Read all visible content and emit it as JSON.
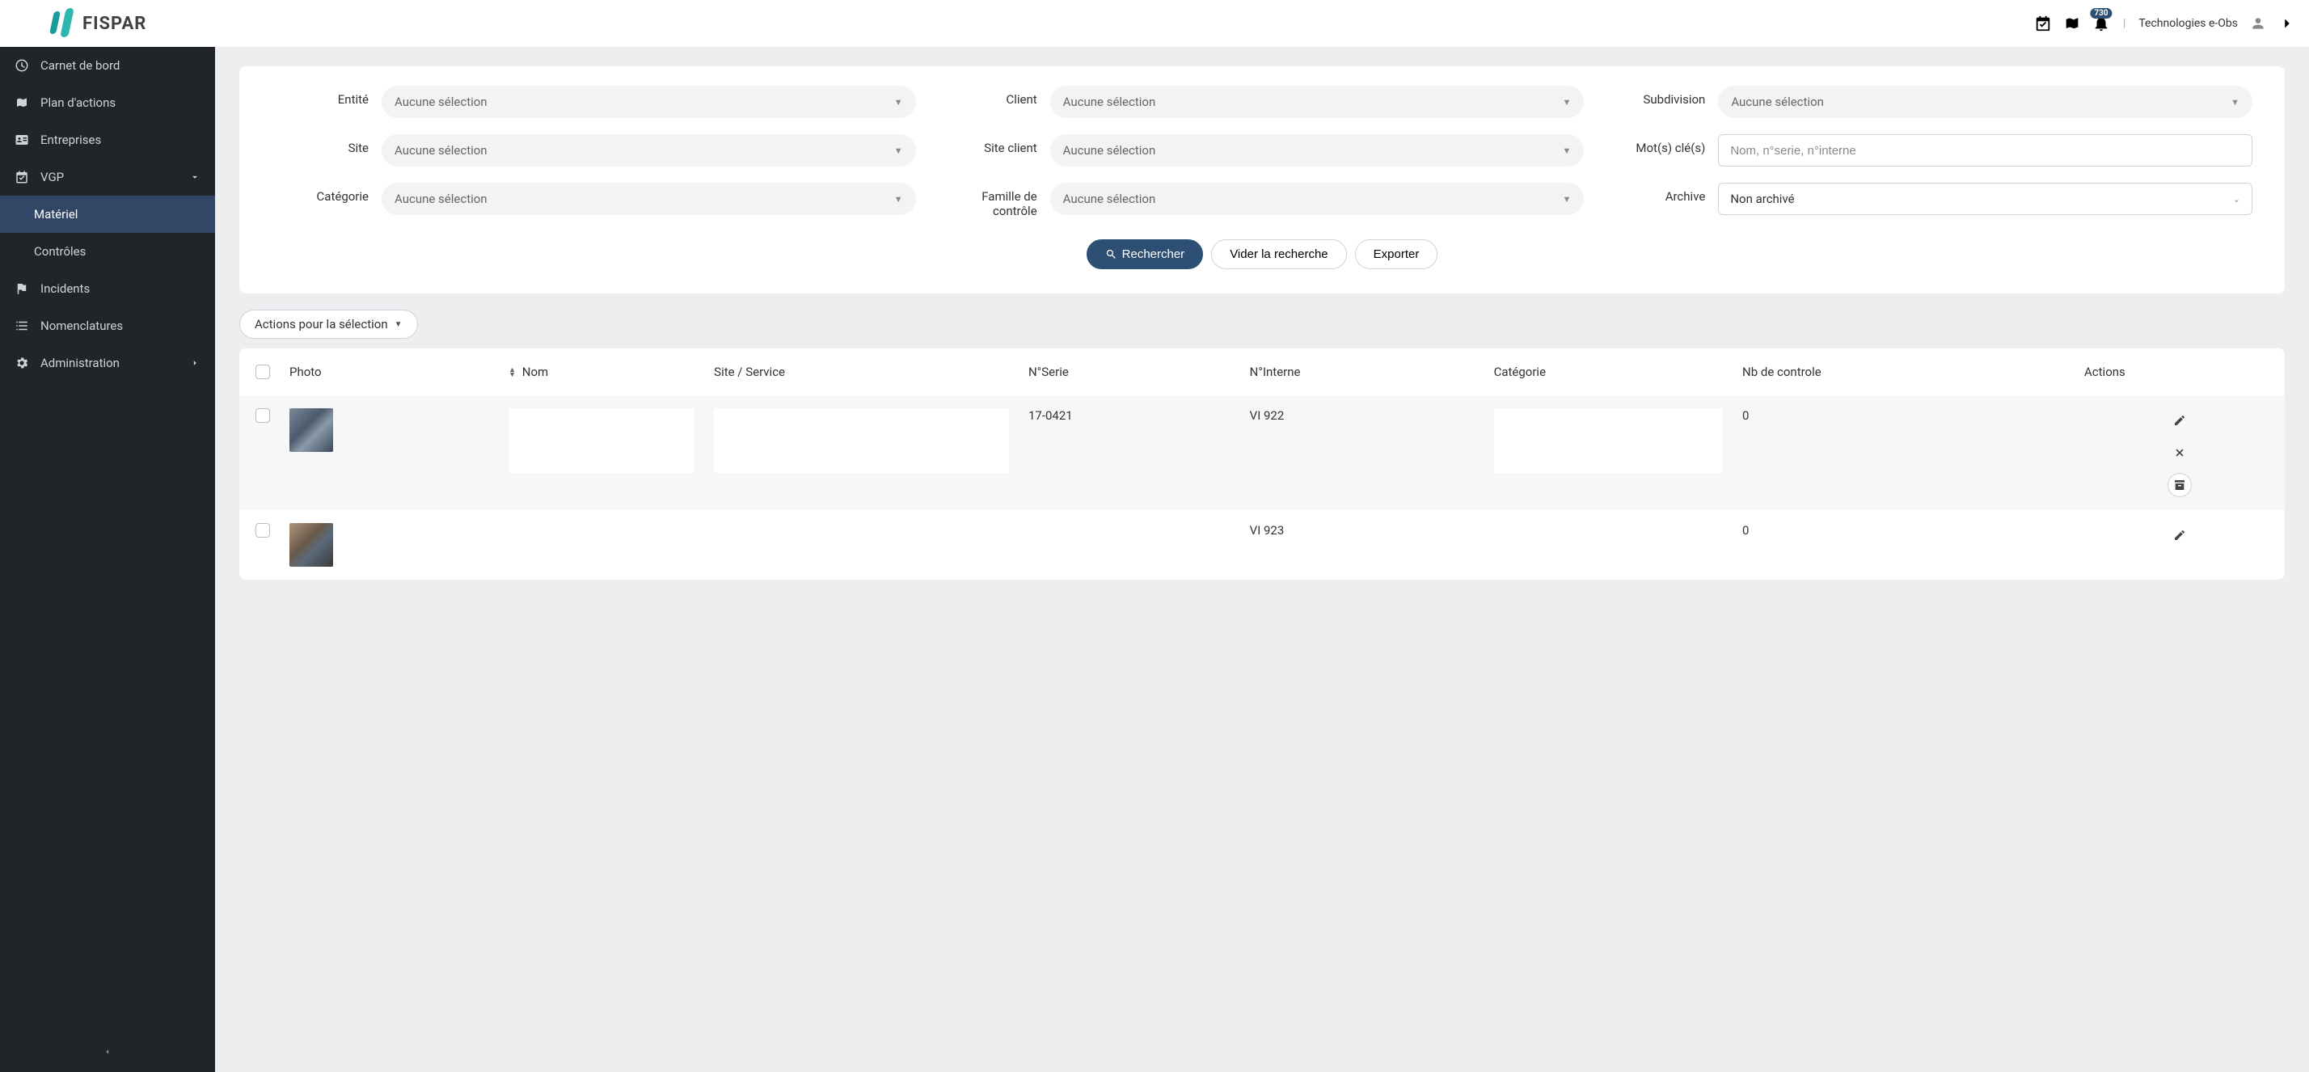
{
  "header": {
    "brand": "FISPAR",
    "notification_count": "730",
    "user_label": "Technologies e-Obs"
  },
  "sidebar": {
    "items": [
      {
        "label": "Carnet de bord",
        "icon": "dashboard"
      },
      {
        "label": "Plan d'actions",
        "icon": "map"
      },
      {
        "label": "Entreprises",
        "icon": "id-card"
      },
      {
        "label": "VGP",
        "icon": "calendar-check",
        "expandable": true,
        "expanded": true
      },
      {
        "label": "Matériel",
        "sub": true,
        "active": true
      },
      {
        "label": "Contrôles",
        "sub": true
      },
      {
        "label": "Incidents",
        "icon": "flag"
      },
      {
        "label": "Nomenclatures",
        "icon": "list"
      },
      {
        "label": "Administration",
        "icon": "gear",
        "expandable": true
      }
    ]
  },
  "filters": {
    "labels": {
      "entite": "Entité",
      "client": "Client",
      "subdivision": "Subdivision",
      "site": "Site",
      "site_client": "Site client",
      "motcle": "Mot(s) clé(s)",
      "categorie": "Catégorie",
      "famille_controle": "Famille de contrôle",
      "archive": "Archive"
    },
    "placeholder_select": "Aucune sélection",
    "placeholder_keywords": "Nom, n°serie, n°interne",
    "archive_value": "Non archivé",
    "buttons": {
      "search": "Rechercher",
      "clear": "Vider la recherche",
      "export": "Exporter"
    }
  },
  "bulk_actions_label": "Actions pour la sélection",
  "table": {
    "headers": {
      "photo": "Photo",
      "nom": "Nom",
      "site_service": "Site / Service",
      "nserie": "N°Serie",
      "ninterne": "N°Interne",
      "categorie": "Catégorie",
      "nb_controle": "Nb de controle",
      "actions": "Actions"
    },
    "rows": [
      {
        "nserie": "17-0421",
        "ninterne": "VI 922",
        "nb_controle": "0"
      },
      {
        "nserie": "",
        "ninterne": "VI 923",
        "nb_controle": "0"
      }
    ]
  }
}
